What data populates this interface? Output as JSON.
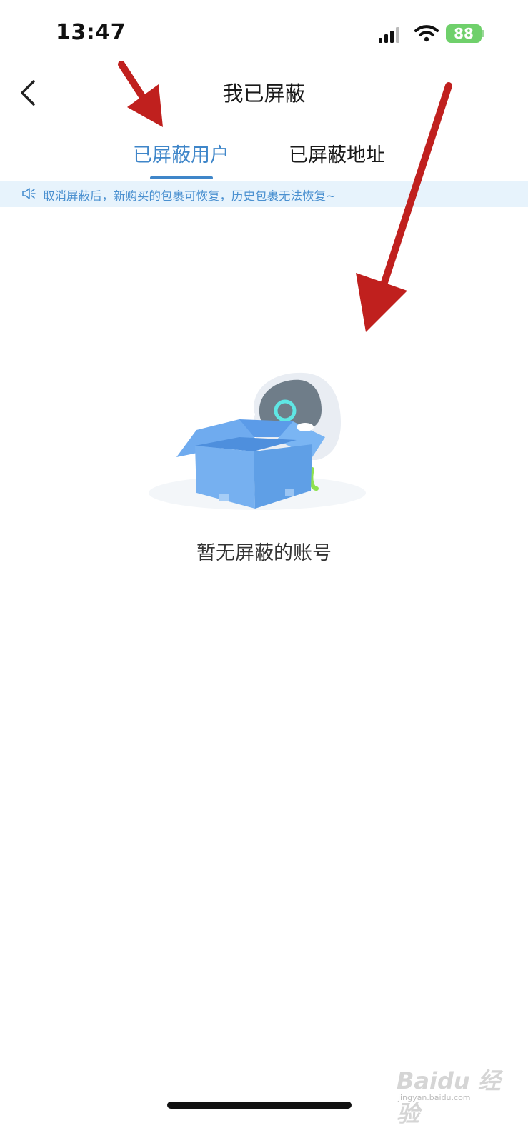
{
  "status_bar": {
    "time": "13:47",
    "battery": "88",
    "icons": [
      "signal-icon",
      "wifi-icon",
      "battery-icon",
      "charging-bolt-icon"
    ]
  },
  "nav": {
    "title": "我已屏蔽",
    "back_icon": "back-chevron-icon"
  },
  "tabs": [
    {
      "label": "已屏蔽用户",
      "active": true
    },
    {
      "label": "已屏蔽地址",
      "active": false
    }
  ],
  "notice": {
    "icon": "speaker-icon",
    "text": "取消屏蔽后，新购买的包裹可恢复，历史包裹无法恢复~"
  },
  "empty_state": {
    "illustration": "empty-box-robot-illustration",
    "text": "暂无屏蔽的账号"
  },
  "watermark": {
    "logo": "Baidu 经验",
    "sub": "jingyan.baidu.com"
  },
  "colors": {
    "accent": "#3f86c9",
    "notice_bg": "#e7f3fc",
    "notice_text": "#4a90d0",
    "battery": "#6fd06b",
    "annotation_arrow": "#c0201e"
  }
}
